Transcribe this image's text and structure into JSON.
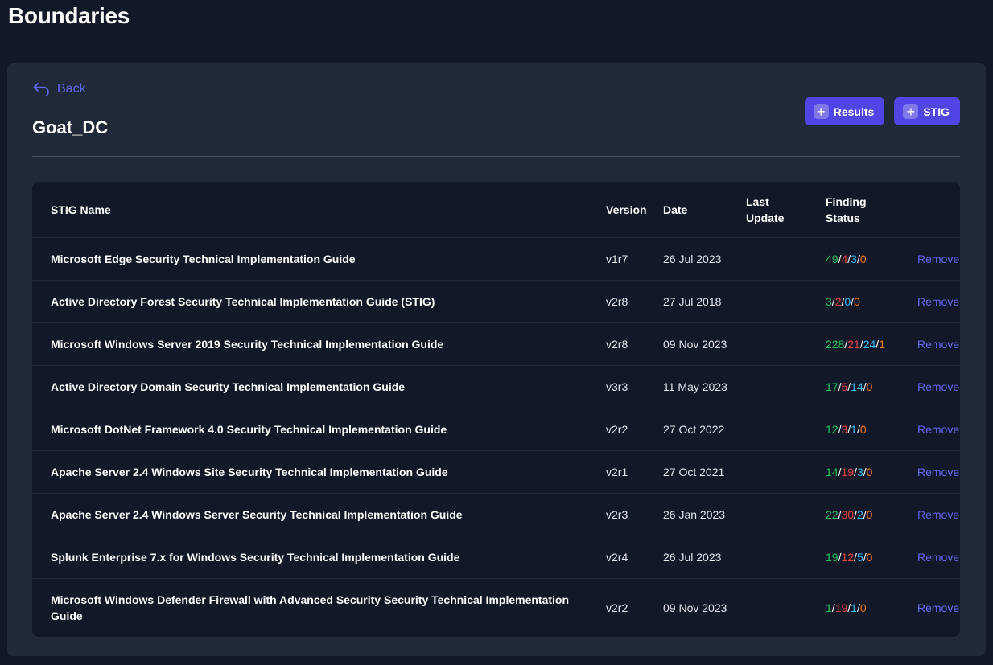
{
  "page": {
    "title": "Boundaries"
  },
  "boundary": {
    "back_label": "Back",
    "name": "Goat_DC",
    "buttons": {
      "results_label": "Results",
      "stig_label": "STIG"
    }
  },
  "table": {
    "headers": {
      "name": "STIG Name",
      "version": "Version",
      "date": "Date",
      "last_update_line1": "Last",
      "last_update_line2": "Update",
      "finding_status_line1": "Finding",
      "finding_status_line2": "Status"
    },
    "remove_label": "Remove",
    "status_colors": {
      "open": "#22c55e",
      "cat1": "#ef4444",
      "cat2": "#38bdf8",
      "cat3": "#f97316"
    },
    "rows": [
      {
        "name": "Microsoft Edge Security Technical Implementation Guide",
        "version": "v1r7",
        "date": "26 Jul 2023",
        "last_update": "",
        "status": [
          "49",
          "4",
          "3",
          "0"
        ]
      },
      {
        "name": "Active Directory Forest Security Technical Implementation Guide (STIG)",
        "version": "v2r8",
        "date": "27 Jul 2018",
        "last_update": "",
        "status": [
          "3",
          "2",
          "0",
          "0"
        ]
      },
      {
        "name": "Microsoft Windows Server 2019 Security Technical Implementation Guide",
        "version": "v2r8",
        "date": "09 Nov 2023",
        "last_update": "",
        "status": [
          "228",
          "21",
          "24",
          "1"
        ]
      },
      {
        "name": "Active Directory Domain Security Technical Implementation Guide",
        "version": "v3r3",
        "date": "11 May 2023",
        "last_update": "",
        "status": [
          "17",
          "5",
          "14",
          "0"
        ]
      },
      {
        "name": "Microsoft DotNet Framework 4.0 Security Technical Implementation Guide",
        "version": "v2r2",
        "date": "27 Oct 2022",
        "last_update": "",
        "status": [
          "12",
          "3",
          "1",
          "0"
        ]
      },
      {
        "name": "Apache Server 2.4 Windows Site Security Technical Implementation Guide",
        "version": "v2r1",
        "date": "27 Oct 2021",
        "last_update": "",
        "status": [
          "14",
          "19",
          "3",
          "0"
        ]
      },
      {
        "name": "Apache Server 2.4 Windows Server Security Technical Implementation Guide",
        "version": "v2r3",
        "date": "26 Jan 2023",
        "last_update": "",
        "status": [
          "22",
          "30",
          "2",
          "0"
        ]
      },
      {
        "name": "Splunk Enterprise 7.x for Windows Security Technical Implementation Guide",
        "version": "v2r4",
        "date": "26 Jul 2023",
        "last_update": "",
        "status": [
          "19",
          "12",
          "5",
          "0"
        ]
      },
      {
        "name": "Microsoft Windows Defender Firewall with Advanced Security Security Technical Implementation Guide",
        "version": "v2r2",
        "date": "09 Nov 2023",
        "last_update": "",
        "status": [
          "1",
          "19",
          "1",
          "0"
        ]
      }
    ]
  }
}
